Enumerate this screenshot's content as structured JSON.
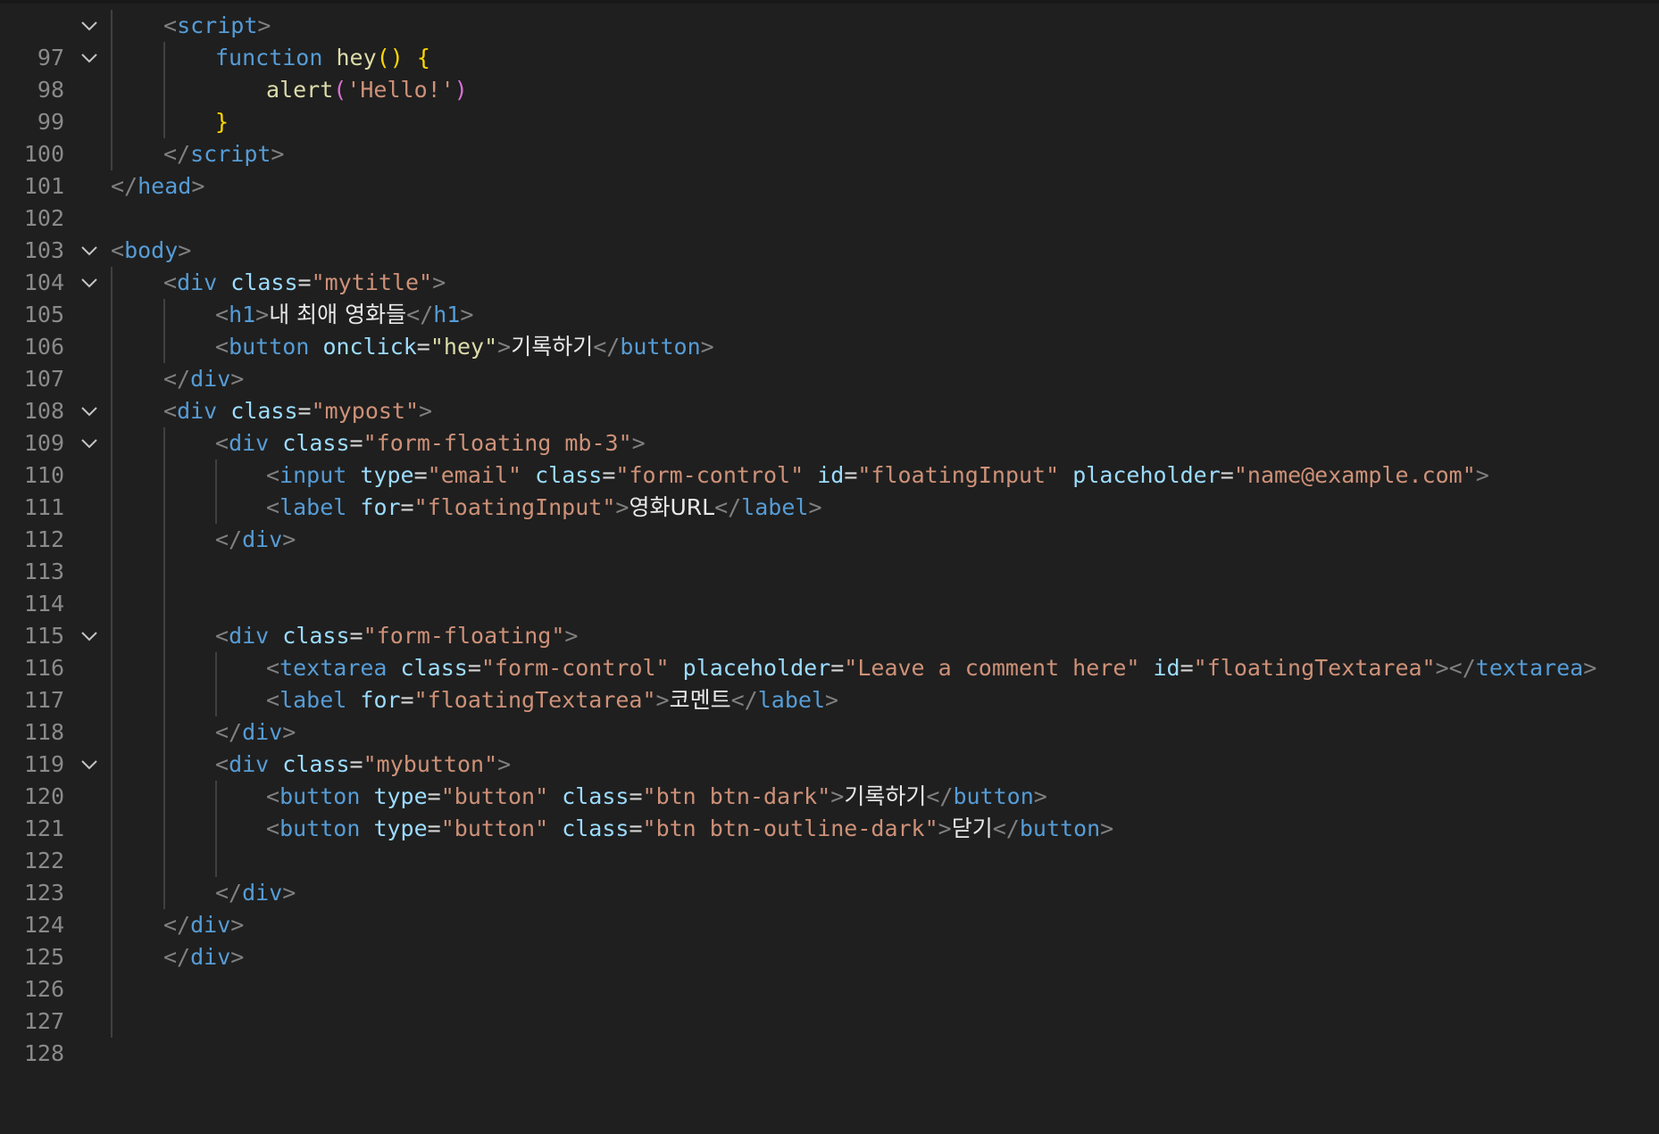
{
  "editor": {
    "line_numbers": [
      "97",
      "98",
      "99",
      "100",
      "101",
      "102",
      "103",
      "104",
      "105",
      "106",
      "107",
      "108",
      "109",
      "110",
      "111",
      "112",
      "113",
      "114",
      "115",
      "116",
      "117",
      "118",
      "119",
      "120",
      "121",
      "122",
      "123",
      "124",
      "125",
      "126",
      "127",
      "128"
    ],
    "code": {
      "l97": {
        "tag": "script"
      },
      "l98": {
        "kw": "function",
        "fn": "hey",
        "parens": "()",
        "brace": "{"
      },
      "l99": {
        "fn": "alert",
        "open": "(",
        "str": "'Hello!'",
        "close": ")"
      },
      "l100": {
        "brace": "}"
      },
      "l101": {
        "tag": "script"
      },
      "l102": {
        "tag": "head"
      },
      "l104": {
        "tag": "body"
      },
      "l105": {
        "tag": "div",
        "attr": "class",
        "val": "\"mytitle\""
      },
      "l106": {
        "tag": "h1",
        "text": "내 최애 영화들",
        "close_tag": "h1"
      },
      "l107": {
        "tag": "button",
        "attr": "onclick",
        "val": "\"hey\"",
        "text": "기록하기",
        "close_tag": "button"
      },
      "l108": {
        "tag": "div"
      },
      "l109": {
        "tag": "div",
        "attr": "class",
        "val": "\"mypost\""
      },
      "l110": {
        "tag": "div",
        "attr": "class",
        "val": "\"form-floating mb-3\""
      },
      "l111": {
        "tag": "input",
        "a1": "type",
        "v1": "\"email\"",
        "a2": "class",
        "v2": "\"form-control\"",
        "a3": "id",
        "v3": "\"floatingInput\"",
        "a4": "placeholder",
        "v4": "\"name@example.com\""
      },
      "l112": {
        "tag": "label",
        "attr": "for",
        "val": "\"floatingInput\"",
        "text": "영화URL",
        "close_tag": "label"
      },
      "l113": {
        "tag": "div"
      },
      "l116": {
        "tag": "div",
        "attr": "class",
        "val": "\"form-floating\""
      },
      "l117": {
        "tag": "textarea",
        "a1": "class",
        "v1": "\"form-control\"",
        "a2": "placeholder",
        "v2": "\"Leave a comment here\"",
        "a3": "id",
        "v3": "\"floatingTextarea\"",
        "close_tag": "textarea"
      },
      "l118": {
        "tag": "label",
        "attr": "for",
        "val": "\"floatingTextarea\"",
        "text": "코멘트",
        "close_tag": "label"
      },
      "l119": {
        "tag": "div"
      },
      "l120": {
        "tag": "div",
        "attr": "class",
        "val": "\"mybutton\""
      },
      "l121": {
        "tag": "button",
        "a1": "type",
        "v1": "\"button\"",
        "a2": "class",
        "v2": "\"btn btn-dark\"",
        "text": "기록하기",
        "close_tag": "button"
      },
      "l122": {
        "tag": "button",
        "a1": "type",
        "v1": "\"button\"",
        "a2": "class",
        "v2": "\"btn btn-outline-dark\"",
        "text": "닫기",
        "close_tag": "button"
      },
      "l124": {
        "tag": "div"
      },
      "l125": {
        "tag": "div"
      },
      "l126": {
        "tag": "div"
      }
    },
    "icons": {
      "fold": "chevron-down-icon"
    },
    "colors": {
      "background": "#1f1f1f",
      "line_number": "#8a8a8a",
      "punctuation": "#808080",
      "tag": "#569cd6",
      "attribute": "#9cdcfe",
      "string": "#ce9178",
      "function": "#dcdcaa",
      "brace": "#ffd700",
      "paren": "#da70d6",
      "text": "#e8e8e8",
      "indent_guide": "#404040"
    }
  }
}
